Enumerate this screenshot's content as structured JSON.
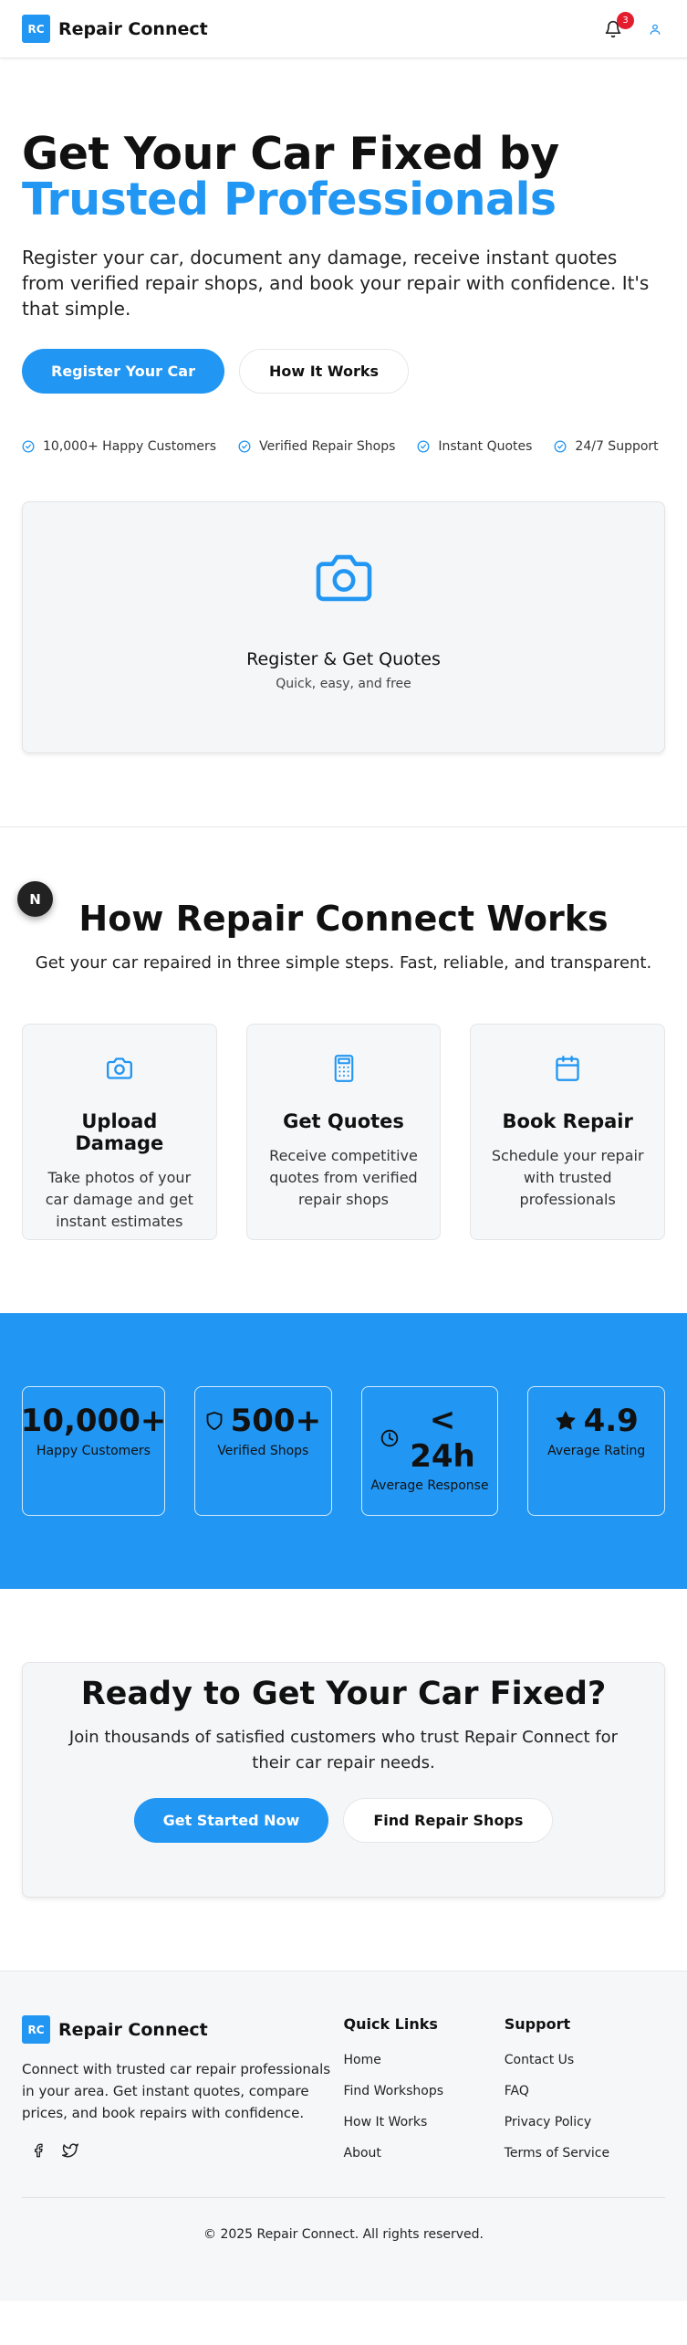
{
  "header": {
    "logo_text": "RC",
    "brand_name": "Repair Connect",
    "notification_count": "3",
    "icons": [
      "bell-icon",
      "user-icon"
    ]
  },
  "hero": {
    "title_part1": "Get Your Car Fixed by ",
    "title_accent": "Trusted Professionals",
    "subtitle": "Register your car, document any damage, receive instant quotes from verified repair shops, and book your repair with confidence. It's that simple.",
    "primary_button": "Register Your Car",
    "secondary_button": "How It Works",
    "features": [
      "10,000+ Happy Customers",
      "Verified Repair Shops",
      "Instant Quotes",
      "24/7 Support"
    ],
    "card_title": "Register & Get Quotes",
    "card_subtitle": "Quick, easy, and free"
  },
  "fab_label": "N",
  "how": {
    "title": "How Repair Connect Works",
    "subtitle": "Get your car repaired in three simple steps. Fast, reliable, and transparent.",
    "steps": [
      {
        "icon": "camera-icon",
        "title": "Upload Damage",
        "description": "Take photos of your car damage and get instant estimates"
      },
      {
        "icon": "calculator-icon",
        "title": "Get Quotes",
        "description": "Receive competitive quotes from verified repair shops"
      },
      {
        "icon": "calendar-icon",
        "title": "Book Repair",
        "description": "Schedule your repair with trusted professionals"
      }
    ]
  },
  "stats": [
    {
      "icon": "",
      "value": "10,000+",
      "label": "Happy Customers"
    },
    {
      "icon": "shield-icon",
      "value": "500+",
      "label": "Verified Shops"
    },
    {
      "icon": "clock-icon",
      "value": "< 24h",
      "label": "Average Response"
    },
    {
      "icon": "star-icon",
      "value": "4.9",
      "label": "Average Rating"
    }
  ],
  "cta": {
    "title": "Ready to Get Your Car Fixed?",
    "subtitle": "Join thousands of satisfied customers who trust Repair Connect for their car repair needs.",
    "primary_button": "Get Started Now",
    "secondary_button": "Find Repair Shops"
  },
  "footer": {
    "logo_text": "RC",
    "brand_name": "Repair Connect",
    "description": "Connect with trusted car repair professionals in your area. Get instant quotes, compare prices, and book repairs with confidence.",
    "quick_links_title": "Quick Links",
    "quick_links": [
      "Home",
      "Find Workshops",
      "How It Works",
      "About"
    ],
    "support_title": "Support",
    "support_links": [
      "Contact Us",
      "FAQ",
      "Privacy Policy",
      "Terms of Service"
    ],
    "copyright": "© 2025 Repair Connect. All rights reserved."
  },
  "colors": {
    "accent": "#2196f3",
    "badge": "#e11d2e",
    "card_background": "#f5f6f7"
  }
}
